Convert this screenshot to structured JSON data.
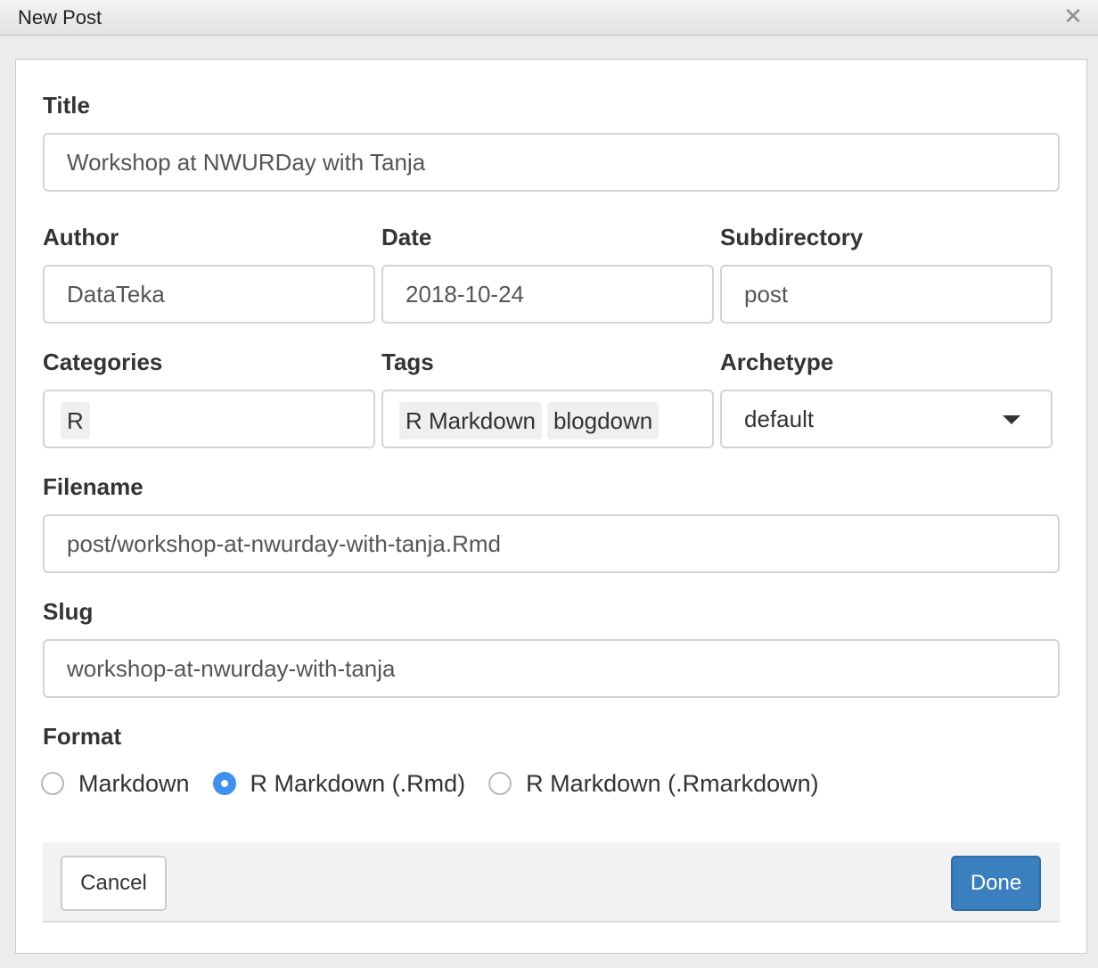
{
  "window": {
    "title": "New Post",
    "close_glyph": "✕"
  },
  "form": {
    "title": {
      "label": "Title",
      "value": "Workshop at NWURDay with Tanja"
    },
    "author": {
      "label": "Author",
      "value": "DataTeka"
    },
    "date": {
      "label": "Date",
      "value": "2018-10-24"
    },
    "subdirectory": {
      "label": "Subdirectory",
      "value": "post"
    },
    "categories": {
      "label": "Categories",
      "items": [
        "R"
      ]
    },
    "tags": {
      "label": "Tags",
      "items": [
        "R Markdown",
        "blogdown"
      ]
    },
    "archetype": {
      "label": "Archetype",
      "value": "default"
    },
    "filename": {
      "label": "Filename",
      "value": "post/workshop-at-nwurday-with-tanja.Rmd"
    },
    "slug": {
      "label": "Slug",
      "value": "workshop-at-nwurday-with-tanja"
    },
    "format": {
      "label": "Format",
      "options": [
        "Markdown",
        "R Markdown (.Rmd)",
        "R Markdown (.Rmarkdown)"
      ],
      "selected": "R Markdown (.Rmd)"
    }
  },
  "buttons": {
    "cancel": "Cancel",
    "done": "Done"
  },
  "colors": {
    "primary": "#3a80be",
    "radio_selected": "#3f91ef"
  },
  "icons": {
    "close": "close-icon",
    "dropdown": "chevron-down-icon"
  }
}
